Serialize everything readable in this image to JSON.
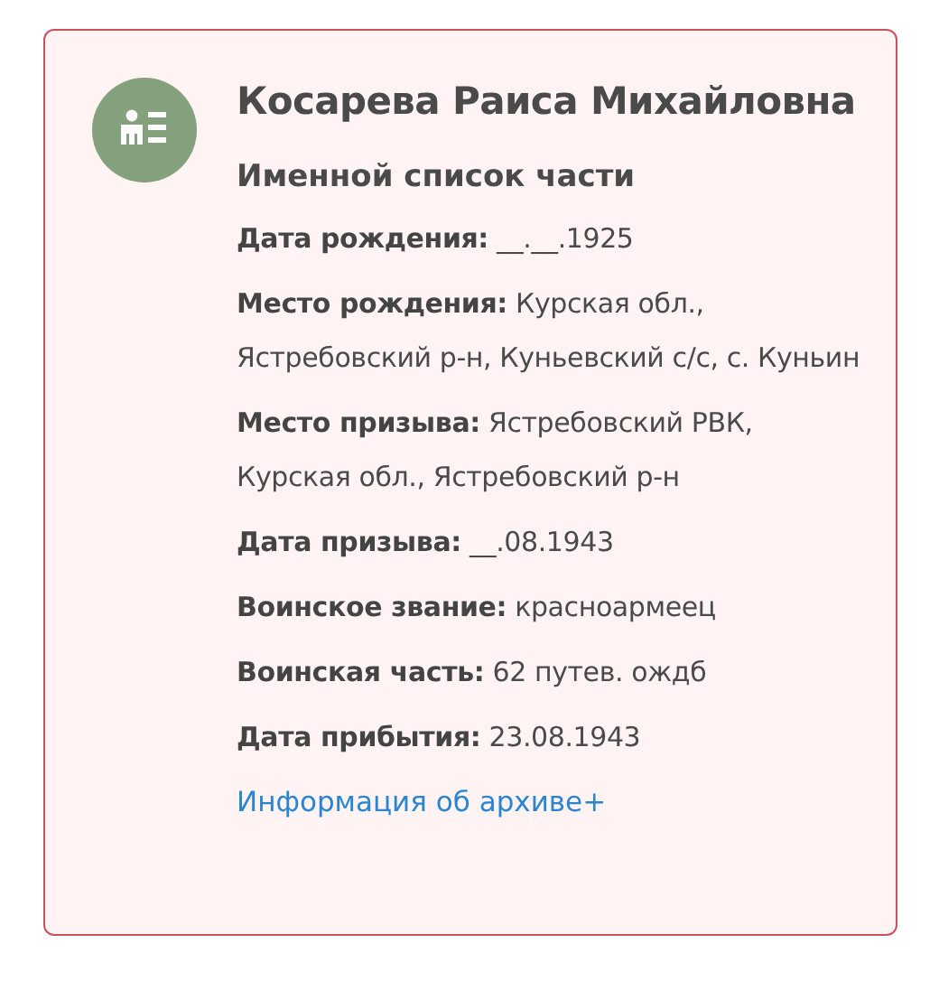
{
  "card": {
    "title": "Косарева Раиса Михайловна",
    "subtitle": "Именной список части",
    "fields": [
      "**Дата рождения:** __.__.1925",
      "**Место рождения:** Курская обл., Ястребовский р-н, Куньевский с/с, с. Куньин",
      "**Место призыва:** Ястребовский РВК, Курская обл., Ястребовский р-н",
      "**Дата призыва:** __.08.1943",
      "**Воинское звание:** красноармеец",
      "**Воинская часть:** 62 путев. ождб",
      "**Дата прибытия:** 23.08.1943"
    ],
    "link": "Информация об архиве+"
  }
}
